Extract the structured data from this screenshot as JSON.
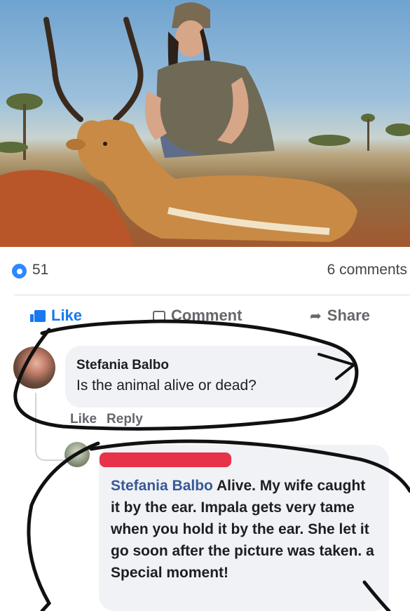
{
  "post": {
    "like_count": "51",
    "comment_count": "6 comments"
  },
  "actions": {
    "like": "Like",
    "comment": "Comment",
    "share": "Share"
  },
  "comments": [
    {
      "author": "Stefania Balbo",
      "text": "Is the animal alive or dead?",
      "like": "Like",
      "reply": "Reply"
    },
    {
      "mention": "Stefania Balbo",
      "text": "Alive. My wife caught it by the ear. Impala gets very tame when you hold it by the ear. She let it go soon after the picture was taken. a Special moment!"
    }
  ],
  "colors": {
    "accent": "#1877f2",
    "mention": "#385898",
    "bubble": "#f0f2f5",
    "ink": "#111111",
    "redaction": "#e8324a"
  }
}
